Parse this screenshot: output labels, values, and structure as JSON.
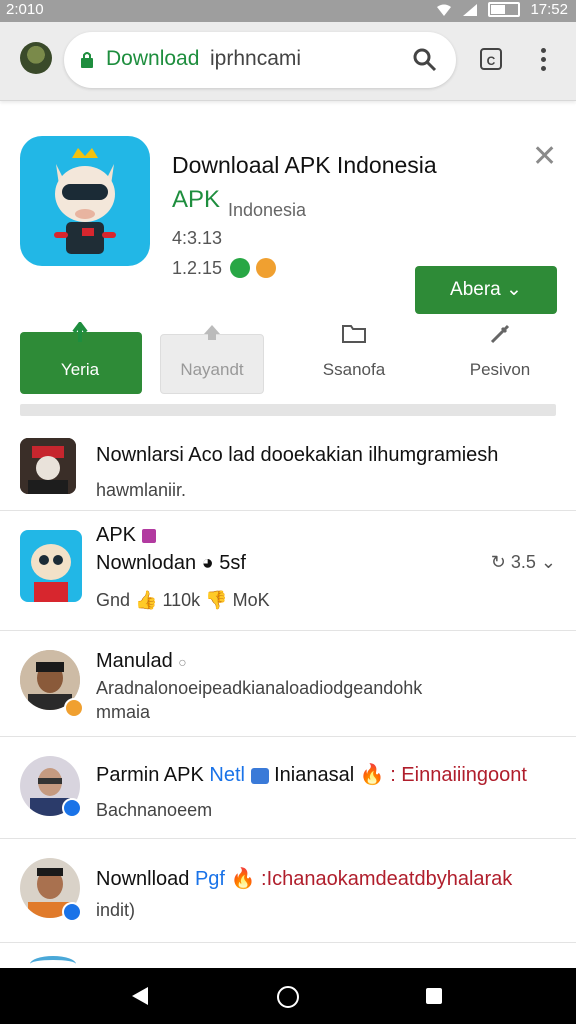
{
  "status_bar": {
    "time_left": "2:010",
    "time_right": "17:52"
  },
  "browser": {
    "url_domain": "Download",
    "url_path": "iprhncami",
    "tab_count": "C"
  },
  "app_card": {
    "title": "Downloaal APK Indonesia",
    "developer": "APK",
    "subtitle": "Indonesia",
    "rating": "4:3.13",
    "size": "1.2.15",
    "open_label": "Abera"
  },
  "actions": [
    {
      "label": "Yeria",
      "icon": "install-icon"
    },
    {
      "label": "Nayandt",
      "icon": "upload-icon"
    },
    {
      "label": "Ssanofa",
      "icon": "folder-icon"
    },
    {
      "label": "Pesivon",
      "icon": "edit-icon"
    }
  ],
  "feed": [
    {
      "line1": "Nownlarsi Aco lad dooekakian ilhumgramiesh",
      "line2": "hawmlaniir."
    },
    {
      "line1_tag": "APK",
      "line1_b": "Nownlodan",
      "line1_c": "5sf",
      "line2": "Gnd",
      "likes": "110k",
      "dislikes": "MoK",
      "version": "3.5"
    },
    {
      "line1": "Manulad",
      "line2": "Aradnalonoeipeadkianaloadiodgeandohk",
      "line3": "mmaia"
    },
    {
      "line1_a": "Parmin APK",
      "line1_b": "Netl",
      "line1_c": "Inianasal",
      "line1_d": ": Einnaiiingoont",
      "line2": "Bachnanoeem"
    },
    {
      "line1_a": "Nownlload",
      "line1_b": "Pgf",
      "line1_c": ":Ichanaokamdeatdbyhalarak",
      "line2": "indit)"
    }
  ],
  "colors": {
    "accent_green": "#2e8b37",
    "link_green": "#1e8e3e",
    "status_gray": "#9e9e9e",
    "icon_blue": "#22b7e6"
  }
}
